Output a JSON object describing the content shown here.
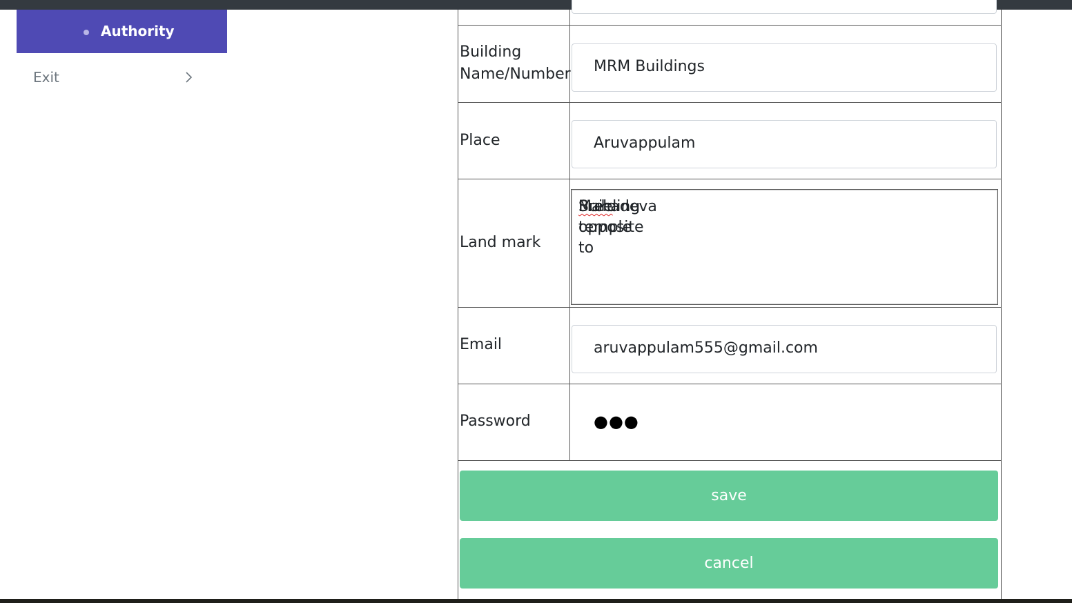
{
  "sidebar": {
    "active_item": "Authority",
    "exit_label": "Exit"
  },
  "form": {
    "building_label": "Building Name/Number",
    "building_line1": "Building",
    "building_line2": "Name/Number",
    "building_value": "MRM Buildings",
    "place_label": "Place",
    "place_value": "Aruvappulam",
    "landmark_label": "Land mark",
    "landmark_before": "Building opposite to ",
    "landmark_misspelled": "Sree",
    "landmark_after": " Mahadeva temple",
    "email_label": "Email",
    "email_value": "aruvappulam555@gmail.com",
    "password_label": "Password",
    "password_mask": "●●●"
  },
  "buttons": {
    "save_label": "save",
    "cancel_label": "cancel"
  },
  "colors": {
    "sidebar_active_bg": "#4f4ab4",
    "button_bg": "#66cc99",
    "topbar": "#343a40"
  }
}
